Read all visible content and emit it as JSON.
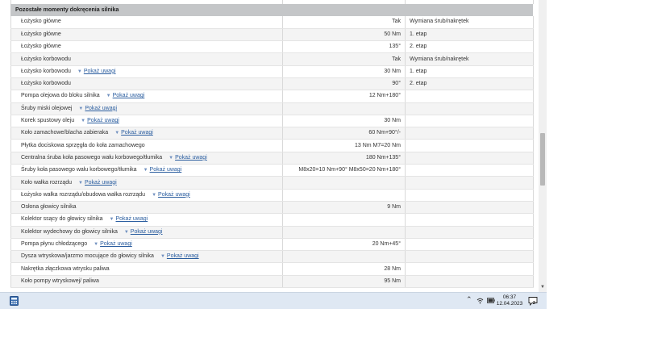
{
  "section": {
    "title": "Pozostałe momenty dokręcenia silnika"
  },
  "rows": [
    {
      "part": "Łożysko główne",
      "note": "",
      "value": "Tak",
      "step": "Wymiana śrub/nakrętek"
    },
    {
      "part": "Łożysko główne",
      "note": "",
      "value": "50 Nm",
      "step": "1. etap"
    },
    {
      "part": "Łożysko główne",
      "note": "",
      "value": "135°",
      "step": "2. etap"
    },
    {
      "part": "Łożysko korbowodu",
      "note": "",
      "value": "Tak",
      "step": "Wymiana śrub/nakrętek"
    },
    {
      "part": "Łożysko korbowodu",
      "note": "Pokaż uwagi",
      "value": "30 Nm",
      "step": "1. etap"
    },
    {
      "part": "Łożysko korbowodu",
      "note": "",
      "value": "90°",
      "step": "2. etap"
    },
    {
      "part": "Pompa olejowa do bloku silnika",
      "note": "Pokaż uwagi",
      "value": "12 Nm+180°",
      "step": ""
    },
    {
      "part": "Śruby miski olejowej",
      "note": "Pokaż uwagi",
      "value": "",
      "step": ""
    },
    {
      "part": "Korek spustowy oleju",
      "note": "Pokaż uwagi",
      "value": "30 Nm",
      "step": ""
    },
    {
      "part": "Koło zamachowe/blacha zabieraka",
      "note": "Pokaż uwagi",
      "value": "60 Nm+90°/-",
      "step": ""
    },
    {
      "part": "Płytka dociskowa sprzęgła do koła zamachowego",
      "note": "",
      "value": "13 Nm M7=20 Nm",
      "step": ""
    },
    {
      "part": "Centralna śruba koła pasowego wału korbowego/tłumika",
      "note": "Pokaż uwagi",
      "value": "180 Nm+135°",
      "step": ""
    },
    {
      "part": "Śruby koła pasowego wału korbowego/tłumika",
      "note": "Pokaż uwagi",
      "value": "M8x20=10 Nm+90° M8x50=20 Nm+180°",
      "step": ""
    },
    {
      "part": "Koło wałka rozrządu",
      "note": "Pokaż uwagi",
      "value": "",
      "step": ""
    },
    {
      "part": "Łożysko wałka rozrządu/obudowa wałka rozrządu",
      "note": "Pokaż uwagi",
      "value": "",
      "step": ""
    },
    {
      "part": "Osłona głowicy silnika",
      "note": "",
      "value": "9 Nm",
      "step": ""
    },
    {
      "part": "Kolektor ssący do głowicy silnika",
      "note": "Pokaż uwagi",
      "value": "",
      "step": ""
    },
    {
      "part": "Kolektor wydechowy do głowicy silnika",
      "note": "Pokaż uwagi",
      "value": "",
      "step": ""
    },
    {
      "part": "Pompa płynu chłodzącego",
      "note": "Pokaż uwagi",
      "value": "20 Nm+45°",
      "step": ""
    },
    {
      "part": "Dysza wtryskowa/jarzmo mocujące do głowicy silnika",
      "note": "Pokaż uwagi",
      "value": "",
      "step": ""
    },
    {
      "part": "Nakrętka złączkowa wtrysku paliwa",
      "note": "",
      "value": "28 Nm",
      "step": ""
    },
    {
      "part": "Koło pompy wtryskowej/ paliwa",
      "note": "",
      "value": "95 Nm",
      "step": ""
    }
  ],
  "taskbar": {
    "time": "06:37",
    "date": "12.04.2023",
    "notification_count": "2",
    "icons": {
      "app": "calculator-icon",
      "tray": "chevron-up-icon",
      "network": "wifi-icon",
      "battery": "battery-icon",
      "notifications": "notification-icon"
    }
  },
  "colors": {
    "header_bg": "#c4c6c8",
    "link": "#2a5d9f",
    "taskbar_bg": "#dfe8f3",
    "row_alt": "#f4f4f4"
  }
}
